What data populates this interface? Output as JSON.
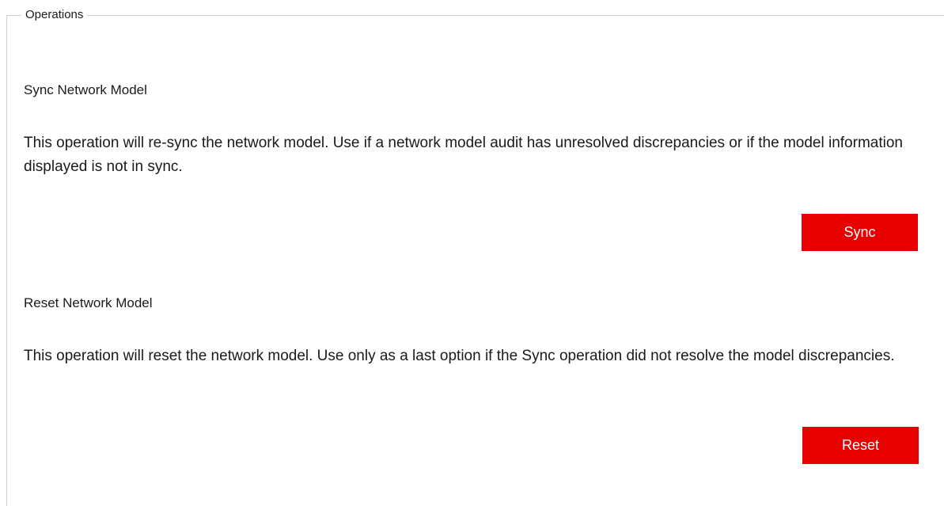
{
  "operations": {
    "legend": "Operations",
    "sync": {
      "title": "Sync Network Model",
      "description": "This operation will re-sync the network model. Use if a network model audit has unresolved discrepancies or if the model information displayed is not in sync.",
      "button_label": "Sync"
    },
    "reset": {
      "title": "Reset Network Model",
      "description": "This operation will reset the network model. Use only as a last option if the Sync operation did not resolve the model discrepancies.",
      "button_label": "Reset"
    }
  },
  "colors": {
    "button_bg": "#e60000",
    "button_text": "#ffffff",
    "border": "#cfcfcf"
  }
}
